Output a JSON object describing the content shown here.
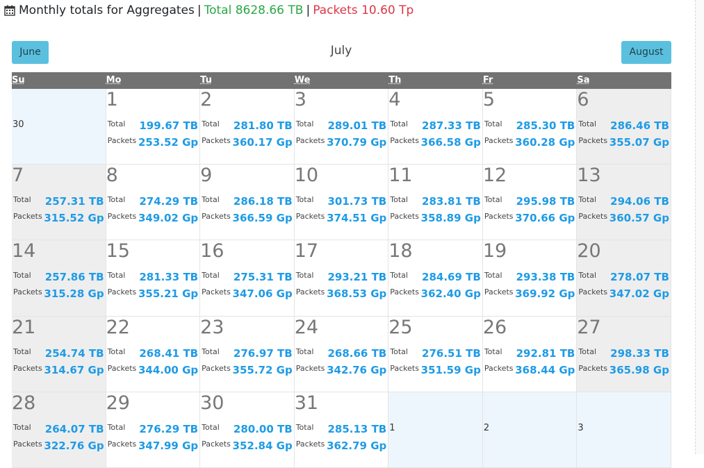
{
  "header": {
    "title": "Monthly totals for Aggregates",
    "separator": "|",
    "total": "Total 8628.66 TB",
    "packets": "Packets 10.60 Tp"
  },
  "nav": {
    "prev": "June",
    "next": "August",
    "month": "July"
  },
  "weekdays": [
    "Su",
    "Mo",
    "Tu",
    "We",
    "Th",
    "Fr",
    "Sa"
  ],
  "labels": {
    "total": "Total",
    "packets": "Packets"
  },
  "weeks": [
    [
      {
        "day": "30",
        "other": true
      },
      {
        "day": "1",
        "total": "199.67 TB",
        "packets": "253.52 Gp"
      },
      {
        "day": "2",
        "total": "281.80 TB",
        "packets": "360.17 Gp"
      },
      {
        "day": "3",
        "total": "289.01 TB",
        "packets": "370.79 Gp"
      },
      {
        "day": "4",
        "total": "287.33 TB",
        "packets": "366.58 Gp"
      },
      {
        "day": "5",
        "total": "285.30 TB",
        "packets": "360.28 Gp"
      },
      {
        "day": "6",
        "total": "286.46 TB",
        "packets": "355.07 Gp"
      }
    ],
    [
      {
        "day": "7",
        "total": "257.31 TB",
        "packets": "315.52 Gp"
      },
      {
        "day": "8",
        "total": "274.29 TB",
        "packets": "349.02 Gp"
      },
      {
        "day": "9",
        "total": "286.18 TB",
        "packets": "366.59 Gp"
      },
      {
        "day": "10",
        "total": "301.73 TB",
        "packets": "374.51 Gp"
      },
      {
        "day": "11",
        "total": "283.81 TB",
        "packets": "358.89 Gp"
      },
      {
        "day": "12",
        "total": "295.98 TB",
        "packets": "370.66 Gp"
      },
      {
        "day": "13",
        "total": "294.06 TB",
        "packets": "360.57 Gp"
      }
    ],
    [
      {
        "day": "14",
        "total": "257.86 TB",
        "packets": "315.28 Gp"
      },
      {
        "day": "15",
        "total": "281.33 TB",
        "packets": "355.21 Gp"
      },
      {
        "day": "16",
        "total": "275.31 TB",
        "packets": "347.06 Gp"
      },
      {
        "day": "17",
        "total": "293.21 TB",
        "packets": "368.53 Gp"
      },
      {
        "day": "18",
        "total": "284.69 TB",
        "packets": "362.40 Gp"
      },
      {
        "day": "19",
        "total": "293.38 TB",
        "packets": "369.92 Gp"
      },
      {
        "day": "20",
        "total": "278.07 TB",
        "packets": "347.02 Gp"
      }
    ],
    [
      {
        "day": "21",
        "total": "254.74 TB",
        "packets": "314.67 Gp"
      },
      {
        "day": "22",
        "total": "268.41 TB",
        "packets": "344.00 Gp"
      },
      {
        "day": "23",
        "total": "276.97 TB",
        "packets": "355.72 Gp"
      },
      {
        "day": "24",
        "total": "268.66 TB",
        "packets": "342.76 Gp"
      },
      {
        "day": "25",
        "total": "276.51 TB",
        "packets": "351.59 Gp"
      },
      {
        "day": "26",
        "total": "292.81 TB",
        "packets": "368.44 Gp"
      },
      {
        "day": "27",
        "total": "298.33 TB",
        "packets": "365.98 Gp"
      }
    ],
    [
      {
        "day": "28",
        "total": "264.07 TB",
        "packets": "322.76 Gp"
      },
      {
        "day": "29",
        "total": "276.29 TB",
        "packets": "347.99 Gp"
      },
      {
        "day": "30",
        "total": "280.00 TB",
        "packets": "352.84 Gp"
      },
      {
        "day": "31",
        "total": "285.13 TB",
        "packets": "362.79 Gp"
      },
      {
        "day": "1",
        "other": true
      },
      {
        "day": "2",
        "other": true
      },
      {
        "day": "3",
        "other": true
      }
    ]
  ]
}
